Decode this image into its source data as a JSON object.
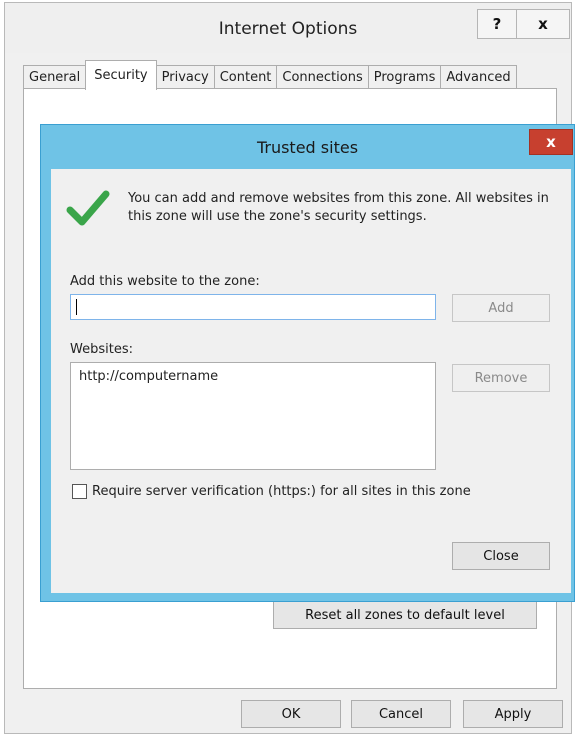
{
  "internet_options": {
    "title": "Internet Options",
    "help_label": "?",
    "close_label": "x",
    "tabs": [
      "General",
      "Security",
      "Privacy",
      "Content",
      "Connections",
      "Programs",
      "Advanced"
    ],
    "active_tab": "Security",
    "reset_button": "Reset all zones to default level",
    "ok_button": "OK",
    "cancel_button": "Cancel",
    "apply_button": "Apply"
  },
  "trusted_sites": {
    "title": "Trusted sites",
    "close_label": "x",
    "info_text": "You can add and remove websites from this zone. All websites in this zone will use the zone's security settings.",
    "add_label": "Add this website to the zone:",
    "add_input_value": "",
    "add_button": "Add",
    "websites_label": "Websites:",
    "websites": [
      "http://computername"
    ],
    "remove_button": "Remove",
    "require_https_label": "Require server verification (https:) for all sites in this zone",
    "require_https_checked": false,
    "close_button": "Close"
  }
}
